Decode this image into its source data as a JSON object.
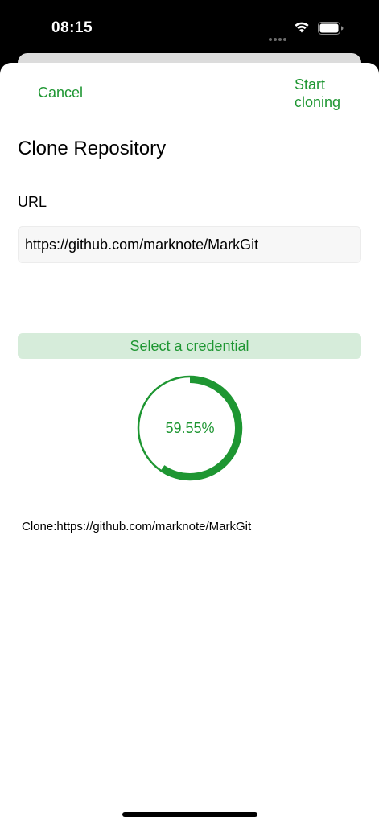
{
  "status_bar": {
    "time": "08:15"
  },
  "nav": {
    "cancel_label": "Cancel",
    "start_label": "Start cloning"
  },
  "page": {
    "title": "Clone Repository",
    "url_label": "URL",
    "url_value": "https://github.com/marknote/MarkGit",
    "credential_label": "Select a credential"
  },
  "progress": {
    "value": 0.5955,
    "text": "59.55%",
    "track_color": "#1e9632",
    "fill_color": "#1e9632"
  },
  "clone_status": "Clone:https://github.com/marknote/MarkGit",
  "colors": {
    "accent": "#1e9632",
    "accent_light": "#d6ecda"
  }
}
